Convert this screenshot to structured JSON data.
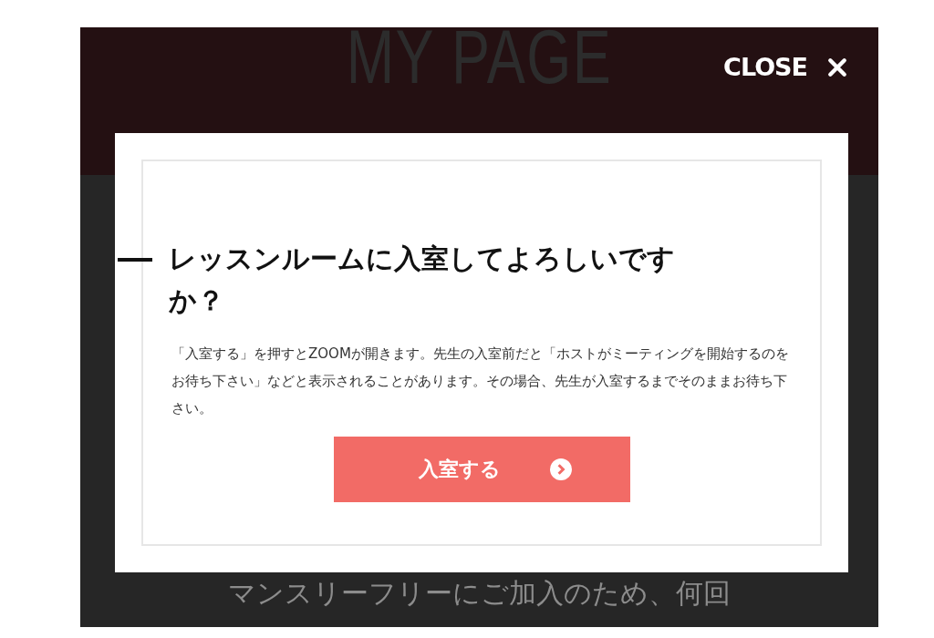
{
  "page_header": {
    "title": "MY PAGE",
    "close_label": "CLOSE"
  },
  "background_text": "マンスリーフリーにご加入のため、何回",
  "dialog": {
    "title": "レッスンルームに入室してよろしいですか？",
    "message": "「入室する」を押すとZOOMが開きます。先生の入室前だと「ホストがミーティングを開始するのをお待ち下さい」などと表示されることがあります。その場合、先生が入室するまでそのままお待ち下さい。",
    "button": "入室する"
  }
}
